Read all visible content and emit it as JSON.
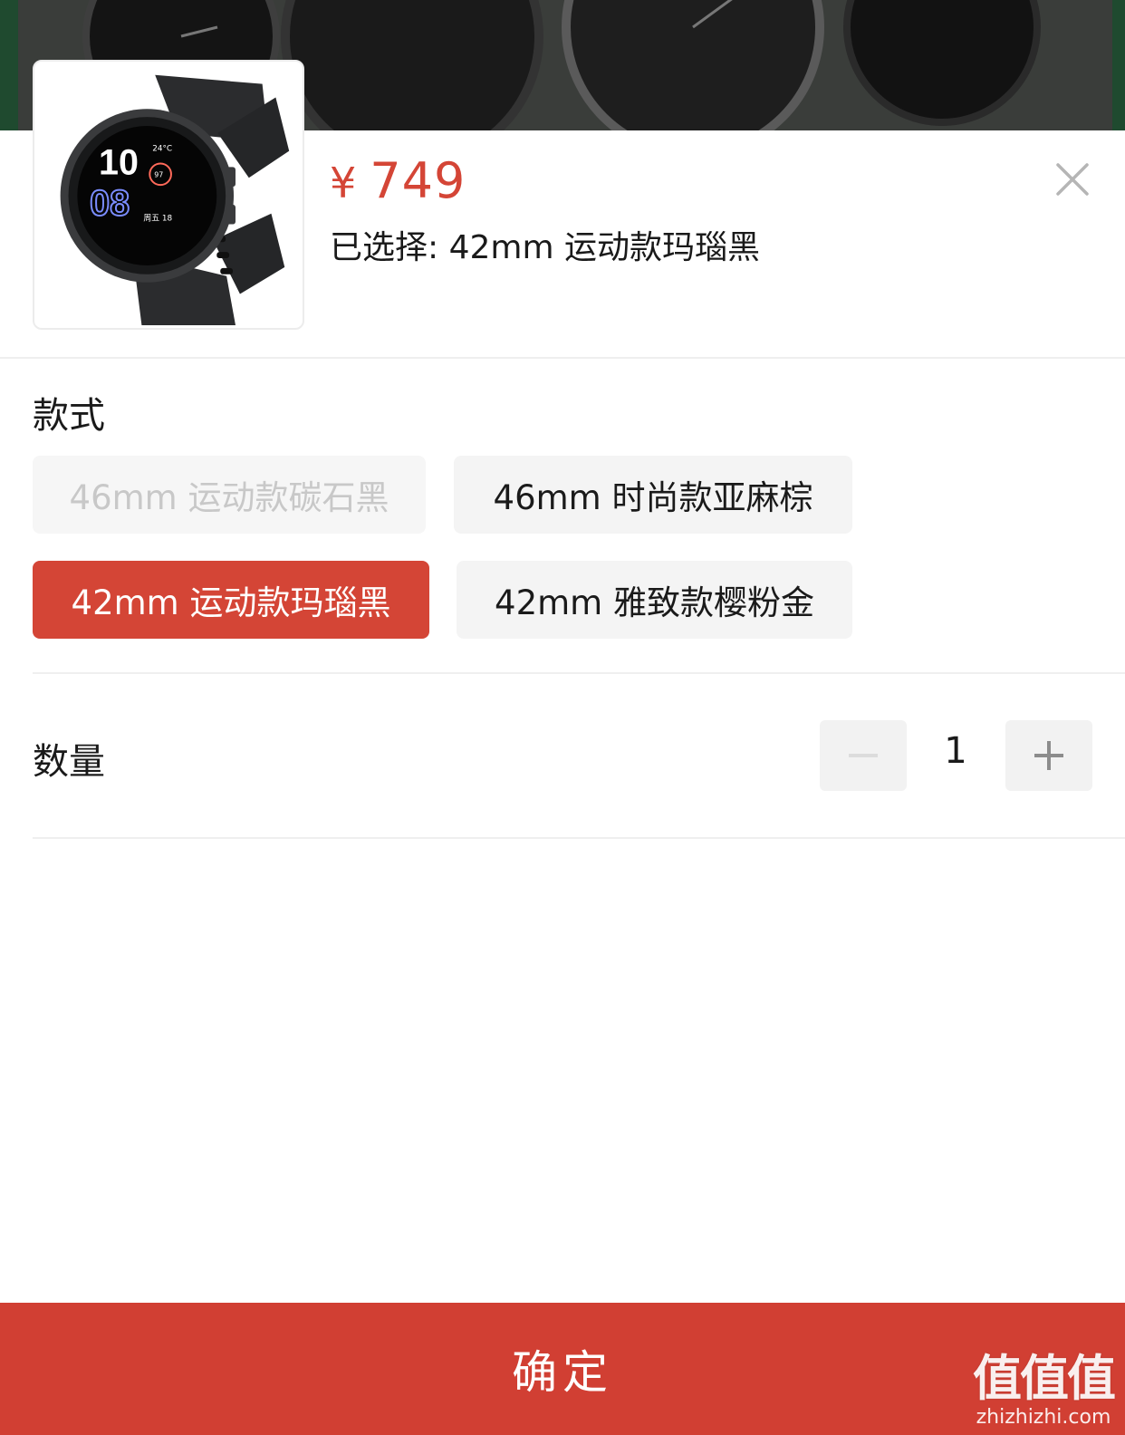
{
  "product": {
    "currency_symbol": "¥",
    "price": "749",
    "selected_label": "已选择: 42mm 运动款玛瑙黑",
    "thumbnail_icon": "smartwatch-icon",
    "watch_face": {
      "hour": "10",
      "minute": "08",
      "temperature": "24°C",
      "heart_rate": "97",
      "date": "周五 18"
    }
  },
  "style_section": {
    "title": "款式",
    "options": [
      {
        "label": "46mm 运动款碳石黑",
        "state": "disabled"
      },
      {
        "label": "46mm 时尚款亚麻棕",
        "state": "normal"
      },
      {
        "label": "42mm 运动款玛瑙黑",
        "state": "selected"
      },
      {
        "label": "42mm 雅致款樱粉金",
        "state": "normal"
      }
    ]
  },
  "quantity_section": {
    "title": "数量",
    "value": "1",
    "minus_icon": "minus-icon",
    "plus_icon": "plus-icon"
  },
  "footer": {
    "confirm_label": "确定"
  },
  "watermark": {
    "logo": "值值值",
    "url": "zhizhizhi.com"
  },
  "colors": {
    "accent": "#d44536",
    "confirm_bg": "#d13f33",
    "option_bg": "#f4f4f4",
    "disabled_text": "#c8c8c8"
  }
}
